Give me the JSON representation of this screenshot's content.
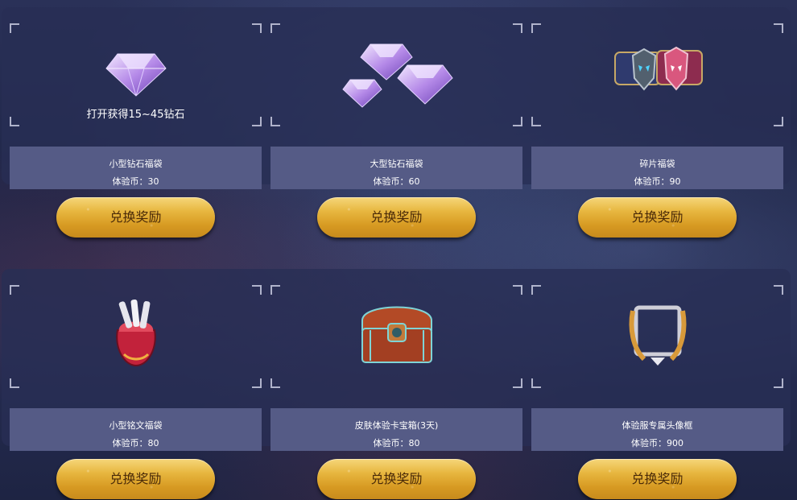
{
  "cards": [
    {
      "name": "小型钻石福袋",
      "price": "体验币：30",
      "hint": "打开获得15~45钻石",
      "icon": "small-diamond-bag-icon"
    },
    {
      "name": "大型钻石福袋",
      "price": "体验币：60",
      "hint": "",
      "icon": "large-diamond-bag-icon"
    },
    {
      "name": "碎片福袋",
      "price": "体验币：90",
      "hint": "",
      "icon": "fragment-bag-icon"
    },
    {
      "name": "小型铭文福袋",
      "price": "体验币：80",
      "hint": "",
      "icon": "inscription-bag-icon"
    },
    {
      "name": "皮肤体验卡宝箱(3天)",
      "price": "体验币：80",
      "hint": "",
      "icon": "treasure-chest-icon"
    },
    {
      "name": "体验服专属头像框",
      "price": "体验币：900",
      "hint": "",
      "icon": "avatar-frame-icon"
    }
  ],
  "buttons": [
    {
      "label": "兑换奖励"
    },
    {
      "label": "兑换奖励"
    },
    {
      "label": "兑换奖励"
    },
    {
      "label": "兑换奖励"
    },
    {
      "label": "兑换奖励"
    },
    {
      "label": "兑换奖励"
    }
  ],
  "colors": {
    "info_bg": "#555b86",
    "button_gold": "#e7b63f",
    "panel_bg": "#282e54"
  }
}
